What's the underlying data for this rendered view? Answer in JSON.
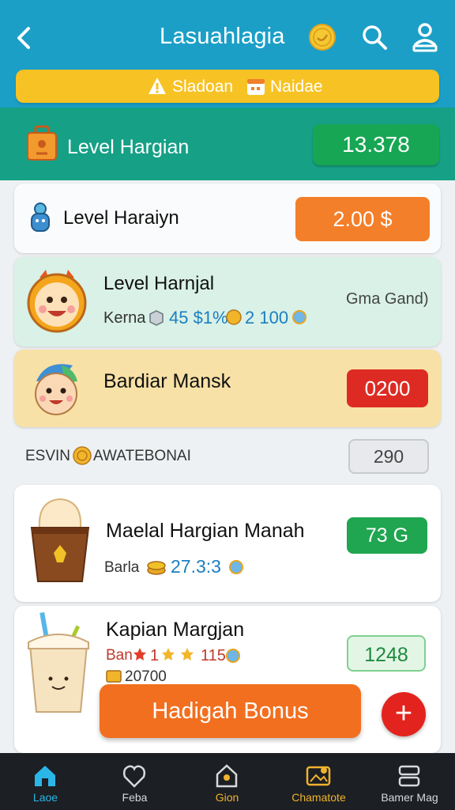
{
  "header": {
    "title": "Lasuahlagia",
    "alert": {
      "text_1": "Sladoan",
      "text_2": "Naidae"
    }
  },
  "level_banner": {
    "label": "Level Hargian",
    "value": "13.378"
  },
  "cards": [
    {
      "title": "Level Haraiyn",
      "badge": "2.00 $"
    },
    {
      "title": "Level Harnjal",
      "meta_label": "Kerna",
      "meta_value_1": "45 $1%",
      "meta_value_2": "2 100",
      "side_text": "Gma Gand)"
    },
    {
      "title": "Bardiar Mansk",
      "badge": "0200"
    }
  ],
  "section": {
    "label_1": "ESVIN",
    "label_2": "AWATEBONAI",
    "value": "290"
  },
  "products": [
    {
      "title": "Maelal Hargian Manah",
      "meta_label": "Barla",
      "meta_value": "27.3:3",
      "badge": "73 G"
    },
    {
      "title": "Kapian Margjan",
      "meta_label": "Ban",
      "meta_value": "1",
      "meta_value_2": "115",
      "sub_value": "20700",
      "badge": "1248"
    }
  ],
  "actions": {
    "main_button": "Hadigah Bonus",
    "add_button": "+"
  },
  "bottom_nav": [
    {
      "label": "Laoe",
      "color": "#2bb6e8"
    },
    {
      "label": "Feba",
      "color": "#d7d9dc"
    },
    {
      "label": "Gion",
      "color": "#f0b32d"
    },
    {
      "label": "Chamatote",
      "color": "#f0b32d"
    },
    {
      "label": "Bamer Mag",
      "color": "#d7d9dc"
    }
  ],
  "colors": {
    "header": "#1b9fc7",
    "alert": "#f7c223",
    "banner": "#16a086",
    "accent_orange": "#f26f1f",
    "accent_red": "#dd2b23",
    "accent_green": "#20a550"
  }
}
